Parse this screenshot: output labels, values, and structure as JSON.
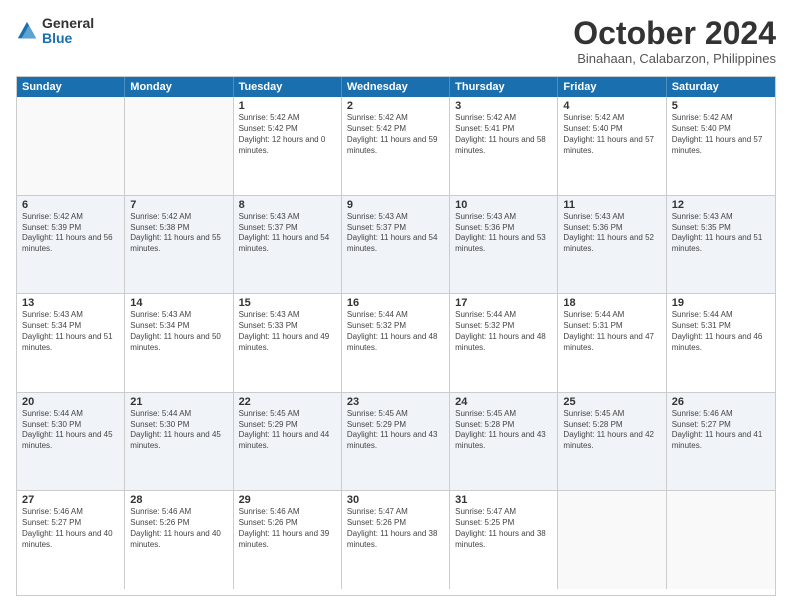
{
  "logo": {
    "general": "General",
    "blue": "Blue"
  },
  "title": "October 2024",
  "location": "Binahaan, Calabarzon, Philippines",
  "days": [
    "Sunday",
    "Monday",
    "Tuesday",
    "Wednesday",
    "Thursday",
    "Friday",
    "Saturday"
  ],
  "weeks": [
    [
      {
        "day": "",
        "sunrise": "",
        "sunset": "",
        "daylight": ""
      },
      {
        "day": "",
        "sunrise": "",
        "sunset": "",
        "daylight": ""
      },
      {
        "day": "1",
        "sunrise": "Sunrise: 5:42 AM",
        "sunset": "Sunset: 5:42 PM",
        "daylight": "Daylight: 12 hours and 0 minutes."
      },
      {
        "day": "2",
        "sunrise": "Sunrise: 5:42 AM",
        "sunset": "Sunset: 5:42 PM",
        "daylight": "Daylight: 11 hours and 59 minutes."
      },
      {
        "day": "3",
        "sunrise": "Sunrise: 5:42 AM",
        "sunset": "Sunset: 5:41 PM",
        "daylight": "Daylight: 11 hours and 58 minutes."
      },
      {
        "day": "4",
        "sunrise": "Sunrise: 5:42 AM",
        "sunset": "Sunset: 5:40 PM",
        "daylight": "Daylight: 11 hours and 57 minutes."
      },
      {
        "day": "5",
        "sunrise": "Sunrise: 5:42 AM",
        "sunset": "Sunset: 5:40 PM",
        "daylight": "Daylight: 11 hours and 57 minutes."
      }
    ],
    [
      {
        "day": "6",
        "sunrise": "Sunrise: 5:42 AM",
        "sunset": "Sunset: 5:39 PM",
        "daylight": "Daylight: 11 hours and 56 minutes."
      },
      {
        "day": "7",
        "sunrise": "Sunrise: 5:42 AM",
        "sunset": "Sunset: 5:38 PM",
        "daylight": "Daylight: 11 hours and 55 minutes."
      },
      {
        "day": "8",
        "sunrise": "Sunrise: 5:43 AM",
        "sunset": "Sunset: 5:37 PM",
        "daylight": "Daylight: 11 hours and 54 minutes."
      },
      {
        "day": "9",
        "sunrise": "Sunrise: 5:43 AM",
        "sunset": "Sunset: 5:37 PM",
        "daylight": "Daylight: 11 hours and 54 minutes."
      },
      {
        "day": "10",
        "sunrise": "Sunrise: 5:43 AM",
        "sunset": "Sunset: 5:36 PM",
        "daylight": "Daylight: 11 hours and 53 minutes."
      },
      {
        "day": "11",
        "sunrise": "Sunrise: 5:43 AM",
        "sunset": "Sunset: 5:36 PM",
        "daylight": "Daylight: 11 hours and 52 minutes."
      },
      {
        "day": "12",
        "sunrise": "Sunrise: 5:43 AM",
        "sunset": "Sunset: 5:35 PM",
        "daylight": "Daylight: 11 hours and 51 minutes."
      }
    ],
    [
      {
        "day": "13",
        "sunrise": "Sunrise: 5:43 AM",
        "sunset": "Sunset: 5:34 PM",
        "daylight": "Daylight: 11 hours and 51 minutes."
      },
      {
        "day": "14",
        "sunrise": "Sunrise: 5:43 AM",
        "sunset": "Sunset: 5:34 PM",
        "daylight": "Daylight: 11 hours and 50 minutes."
      },
      {
        "day": "15",
        "sunrise": "Sunrise: 5:43 AM",
        "sunset": "Sunset: 5:33 PM",
        "daylight": "Daylight: 11 hours and 49 minutes."
      },
      {
        "day": "16",
        "sunrise": "Sunrise: 5:44 AM",
        "sunset": "Sunset: 5:32 PM",
        "daylight": "Daylight: 11 hours and 48 minutes."
      },
      {
        "day": "17",
        "sunrise": "Sunrise: 5:44 AM",
        "sunset": "Sunset: 5:32 PM",
        "daylight": "Daylight: 11 hours and 48 minutes."
      },
      {
        "day": "18",
        "sunrise": "Sunrise: 5:44 AM",
        "sunset": "Sunset: 5:31 PM",
        "daylight": "Daylight: 11 hours and 47 minutes."
      },
      {
        "day": "19",
        "sunrise": "Sunrise: 5:44 AM",
        "sunset": "Sunset: 5:31 PM",
        "daylight": "Daylight: 11 hours and 46 minutes."
      }
    ],
    [
      {
        "day": "20",
        "sunrise": "Sunrise: 5:44 AM",
        "sunset": "Sunset: 5:30 PM",
        "daylight": "Daylight: 11 hours and 45 minutes."
      },
      {
        "day": "21",
        "sunrise": "Sunrise: 5:44 AM",
        "sunset": "Sunset: 5:30 PM",
        "daylight": "Daylight: 11 hours and 45 minutes."
      },
      {
        "day": "22",
        "sunrise": "Sunrise: 5:45 AM",
        "sunset": "Sunset: 5:29 PM",
        "daylight": "Daylight: 11 hours and 44 minutes."
      },
      {
        "day": "23",
        "sunrise": "Sunrise: 5:45 AM",
        "sunset": "Sunset: 5:29 PM",
        "daylight": "Daylight: 11 hours and 43 minutes."
      },
      {
        "day": "24",
        "sunrise": "Sunrise: 5:45 AM",
        "sunset": "Sunset: 5:28 PM",
        "daylight": "Daylight: 11 hours and 43 minutes."
      },
      {
        "day": "25",
        "sunrise": "Sunrise: 5:45 AM",
        "sunset": "Sunset: 5:28 PM",
        "daylight": "Daylight: 11 hours and 42 minutes."
      },
      {
        "day": "26",
        "sunrise": "Sunrise: 5:46 AM",
        "sunset": "Sunset: 5:27 PM",
        "daylight": "Daylight: 11 hours and 41 minutes."
      }
    ],
    [
      {
        "day": "27",
        "sunrise": "Sunrise: 5:46 AM",
        "sunset": "Sunset: 5:27 PM",
        "daylight": "Daylight: 11 hours and 40 minutes."
      },
      {
        "day": "28",
        "sunrise": "Sunrise: 5:46 AM",
        "sunset": "Sunset: 5:26 PM",
        "daylight": "Daylight: 11 hours and 40 minutes."
      },
      {
        "day": "29",
        "sunrise": "Sunrise: 5:46 AM",
        "sunset": "Sunset: 5:26 PM",
        "daylight": "Daylight: 11 hours and 39 minutes."
      },
      {
        "day": "30",
        "sunrise": "Sunrise: 5:47 AM",
        "sunset": "Sunset: 5:26 PM",
        "daylight": "Daylight: 11 hours and 38 minutes."
      },
      {
        "day": "31",
        "sunrise": "Sunrise: 5:47 AM",
        "sunset": "Sunset: 5:25 PM",
        "daylight": "Daylight: 11 hours and 38 minutes."
      },
      {
        "day": "",
        "sunrise": "",
        "sunset": "",
        "daylight": ""
      },
      {
        "day": "",
        "sunrise": "",
        "sunset": "",
        "daylight": ""
      }
    ]
  ]
}
